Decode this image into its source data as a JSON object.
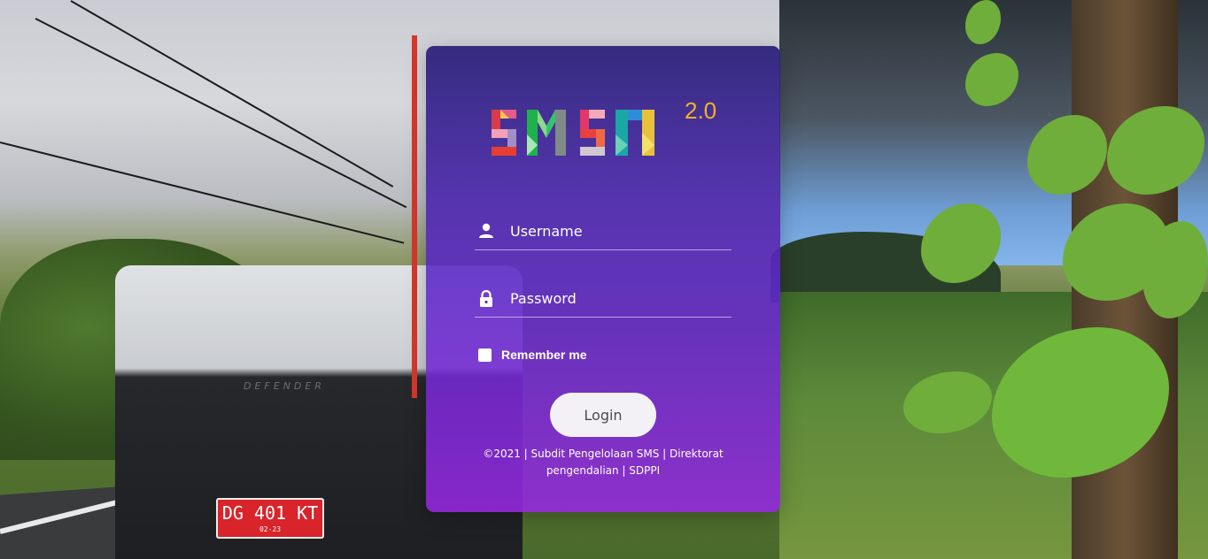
{
  "logo": {
    "text": "SMSN",
    "version": "2.0"
  },
  "form": {
    "username_placeholder": "Username",
    "password_placeholder": "Password",
    "remember_label": "Remember me",
    "login_label": "Login"
  },
  "footer": {
    "line1": "©2021 | Subdit Pengelolaan SMS | Direktorat",
    "line2": "pengendalian | SDPPI"
  },
  "background": {
    "plate_number": "DG 401 KT",
    "plate_sub": "02-23",
    "vehicle_badge": "DEFENDER"
  },
  "colors": {
    "card_top": "#2a1e78",
    "card_bottom": "#9628e1",
    "logo_version": "#f2b02a",
    "button_bg": "#f4f1f6"
  },
  "icons": {
    "username": "user-icon",
    "password": "lock-icon"
  }
}
